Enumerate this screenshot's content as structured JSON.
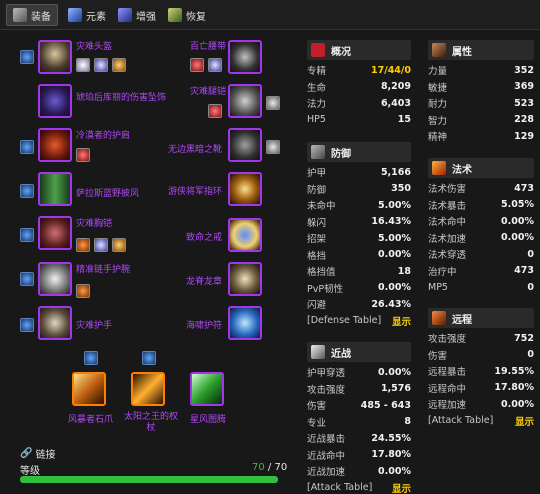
{
  "tabs": [
    {
      "label": "装备",
      "icon": "equipment-icon",
      "color": "#888888"
    },
    {
      "label": "元素",
      "icon": "elemental-icon",
      "color": "#3b6ae0"
    },
    {
      "label": "增强",
      "icon": "enhancement-icon",
      "color": "#4a57c8"
    },
    {
      "label": "恢复",
      "icon": "restoration-icon",
      "color": "#6b8a3a"
    }
  ],
  "left_items": [
    {
      "name": "灾难头盔",
      "icon": "helmet-icon"
    },
    {
      "name": "琥珀后库丽的伤害坠饰",
      "icon": "necklace-icon"
    },
    {
      "name": "冷漠者的护肩",
      "icon": "shoulder-icon"
    },
    {
      "name": "萨拉斯蓝野披风",
      "icon": "cloak-icon"
    },
    {
      "name": "灾难胸铠",
      "icon": "chest-icon"
    },
    {
      "name": "精准链手护腕",
      "icon": "bracer-icon"
    },
    {
      "name": "灾难护手",
      "icon": "gloves-icon"
    }
  ],
  "right_items": [
    {
      "name": "百亡腰带",
      "icon": "belt-icon"
    },
    {
      "name": "灾难腿铠",
      "icon": "legs-icon"
    },
    {
      "name": "无边黑暗之靴",
      "icon": "boots-icon"
    },
    {
      "name": "游侠将军指环",
      "icon": "ring-icon"
    },
    {
      "name": "致命之戒",
      "icon": "ring2-icon"
    },
    {
      "name": "龙脊龙章",
      "icon": "trinket-icon"
    },
    {
      "name": "海啸护符",
      "icon": "trinket2-icon"
    }
  ],
  "weapons": [
    {
      "name": "风暴者石爪",
      "icon": "fist-weapon-icon"
    },
    {
      "name": "太阳之王的权杖",
      "icon": "mace-icon"
    },
    {
      "name": "星风图腾",
      "icon": "totem-icon"
    }
  ],
  "link_label": "链接",
  "level": {
    "label": "等级",
    "current": "70",
    "sep": "/",
    "max": "70",
    "fraction": 1.0
  },
  "overview": {
    "title": "概况",
    "rows": [
      {
        "k": "专精",
        "v": "17/44/0"
      },
      {
        "k": "生命",
        "v": "8,209"
      },
      {
        "k": "法力",
        "v": "6,403"
      },
      {
        "k": "HP5",
        "v": "15"
      }
    ]
  },
  "defense": {
    "title": "防御",
    "rows": [
      {
        "k": "护甲",
        "v": "5,166"
      },
      {
        "k": "防御",
        "v": "350"
      },
      {
        "k": "未命中",
        "v": "5.00%"
      },
      {
        "k": "躲闪",
        "v": "16.43%"
      },
      {
        "k": "招架",
        "v": "5.00%"
      },
      {
        "k": "格挡",
        "v": "0.00%"
      },
      {
        "k": "格挡值",
        "v": "18"
      },
      {
        "k": "PvP韧性",
        "v": "0.00%"
      },
      {
        "k": "闪避",
        "v": "26.43%"
      },
      {
        "k": "[Defense Table]",
        "v": "显示"
      }
    ]
  },
  "melee": {
    "title": "近战",
    "rows": [
      {
        "k": "护甲穿透",
        "v": "0.00%"
      },
      {
        "k": "攻击强度",
        "v": "1,576"
      },
      {
        "k": "伤害",
        "v": "485 - 643"
      },
      {
        "k": "专业",
        "v": "8"
      },
      {
        "k": "近战暴击",
        "v": "24.55%"
      },
      {
        "k": "近战命中",
        "v": "17.80%"
      },
      {
        "k": "近战加速",
        "v": "0.00%"
      },
      {
        "k": "[Attack Table]",
        "v": "显示"
      }
    ]
  },
  "attributes": {
    "title": "属性",
    "rows": [
      {
        "k": "力量",
        "v": "352"
      },
      {
        "k": "敏捷",
        "v": "369"
      },
      {
        "k": "耐力",
        "v": "523"
      },
      {
        "k": "智力",
        "v": "228"
      },
      {
        "k": "精神",
        "v": "129"
      }
    ]
  },
  "spell": {
    "title": "法术",
    "rows": [
      {
        "k": "法术伤害",
        "v": "473"
      },
      {
        "k": "法术暴击",
        "v": "5.05%"
      },
      {
        "k": "法术命中",
        "v": "0.00%"
      },
      {
        "k": "法术加速",
        "v": "0.00%"
      },
      {
        "k": "法术穿透",
        "v": "0"
      },
      {
        "k": "治疗中",
        "v": "473"
      },
      {
        "k": "MP5",
        "v": "0"
      }
    ]
  },
  "ranged": {
    "title": "远程",
    "rows": [
      {
        "k": "攻击强度",
        "v": "752"
      },
      {
        "k": "伤害",
        "v": "0"
      },
      {
        "k": "远程暴击",
        "v": "19.55%"
      },
      {
        "k": "远程命中",
        "v": "17.80%"
      },
      {
        "k": "远程加速",
        "v": "0.00%"
      },
      {
        "k": "[Attack Table]",
        "v": "显示"
      }
    ]
  }
}
